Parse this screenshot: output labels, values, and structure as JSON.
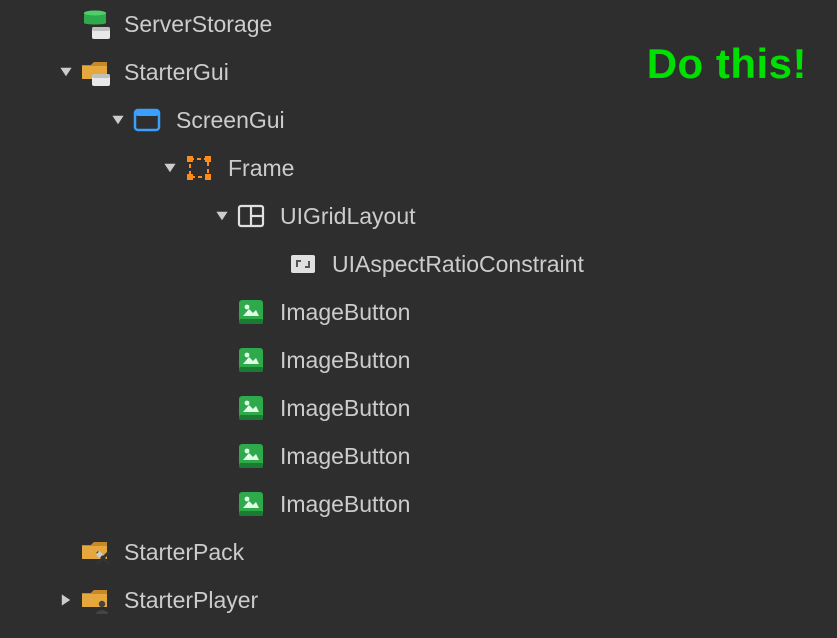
{
  "annotation": "Do this!",
  "tree": {
    "serverStorage": "ServerStorage",
    "starterGui": "StarterGui",
    "screenGui": "ScreenGui",
    "frame": "Frame",
    "uiGridLayout": "UIGridLayout",
    "uiAspectRatioConstraint": "UIAspectRatioConstraint",
    "imageButton1": "ImageButton",
    "imageButton2": "ImageButton",
    "imageButton3": "ImageButton",
    "imageButton4": "ImageButton",
    "imageButton5": "ImageButton",
    "starterPack": "StarterPack",
    "starterPlayer": "StarterPlayer"
  }
}
